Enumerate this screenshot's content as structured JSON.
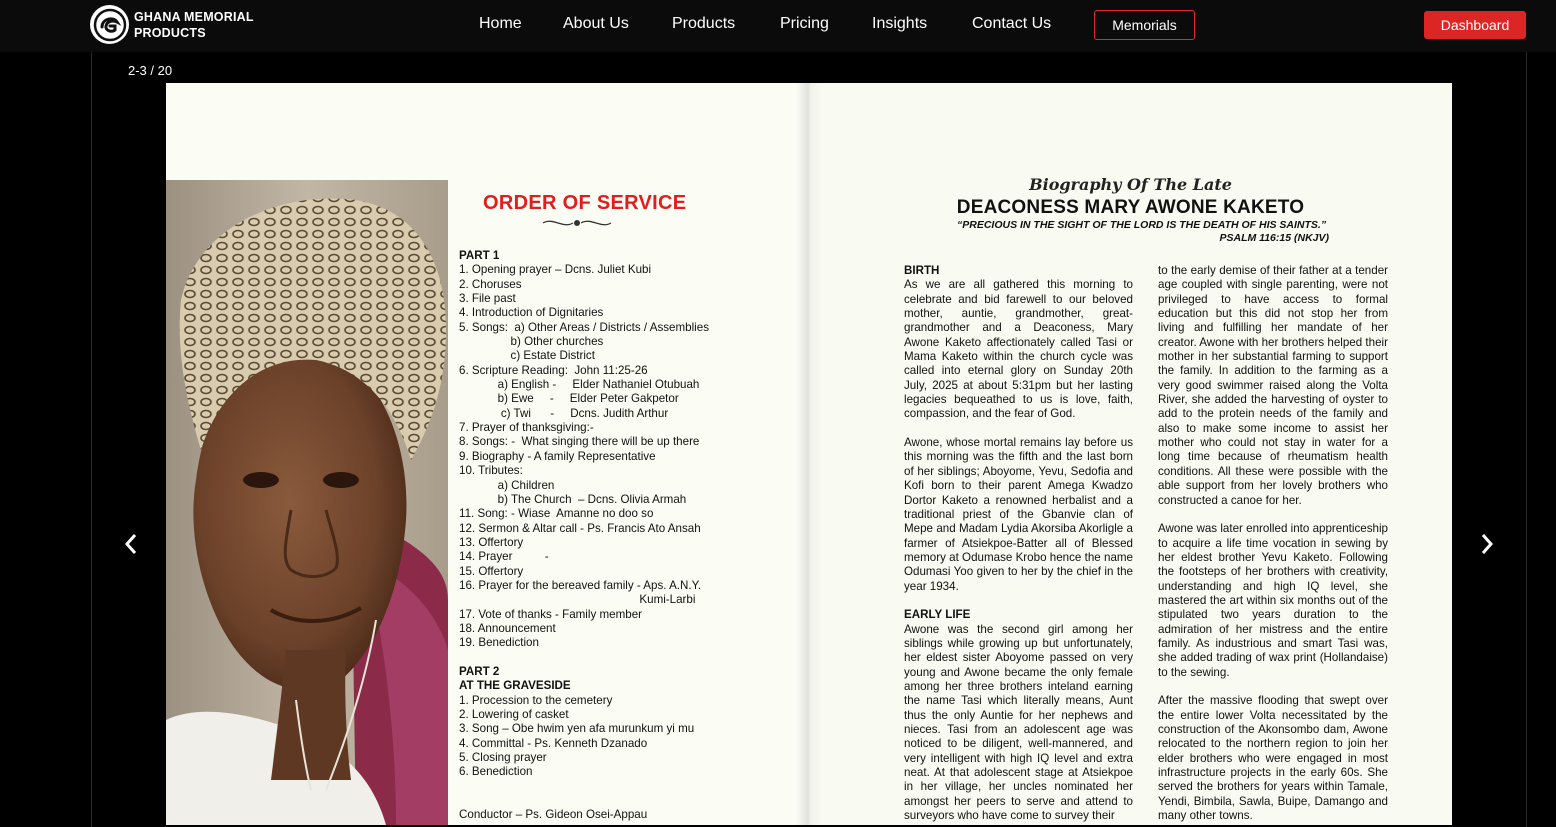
{
  "brand": {
    "line1": "GHANA MEMORIAL",
    "line2": "PRODUCTS",
    "logo_icon": "memorial-logo-icon"
  },
  "nav": {
    "home": "Home",
    "about": "About Us",
    "products": "Products",
    "pricing": "Pricing",
    "insights": "Insights",
    "contact": "Contact Us",
    "memorials": "Memorials",
    "dashboard": "Dashboard"
  },
  "colors": {
    "accent": "#dc2626",
    "nav_bg": "#0b0b0b"
  },
  "viewer": {
    "counter": "2-3 / 20",
    "prev_icon": "chevron-left-icon",
    "next_icon": "chevron-right-icon"
  },
  "order": {
    "title": "ORDER OF SERVICE",
    "part1": "PART 1",
    "lines1": [
      "1. Opening prayer – Dcns. Juliet Kubi",
      "2. Choruses",
      "3. File past",
      "4. Introduction of Dignitaries",
      "5. Songs:  a) Other Areas / Districts / Assemblies",
      "                b) Other churches",
      "                c) Estate District",
      "6. Scripture Reading:  John 11:25-26",
      "            a) English -     Elder Nathaniel Otubuah",
      "            b) Ewe     -     Elder Peter Gakpetor",
      "             c) Twi      -     Dcns. Judith Arthur",
      "7. Prayer of thanksgiving:-",
      "8. Songs: -  What singing there will be up there",
      "9. Biography - A family Representative",
      "10. Tributes:",
      "            a) Children",
      "            b) The Church  – Dcns. Olivia Armah",
      "11. Song: - Wiase  Amanne no doo so",
      "12. Sermon & Altar call - Ps. Francis Ato Ansah",
      "13. Offertory",
      "14. Prayer          -",
      "15. Offertory",
      "16. Prayer for the bereaved family - Aps. A.N.Y.",
      "                                                        Kumi-Larbi",
      "17. Vote of thanks - Family member",
      "18. Announcement",
      "19. Benediction"
    ],
    "part2": "PART 2",
    "graveside": "AT THE GRAVESIDE",
    "lines2": [
      "1. Procession to the cemetery",
      "2. Lowering of casket",
      "3. Song – Obe hwim yen afa murunkum yi mu",
      "4. Committal - Ps. Kenneth Dzanado",
      "5. Closing prayer",
      "6. Benediction"
    ],
    "conductor": "Conductor – Ps. Gideon Osei-Appau"
  },
  "bio": {
    "script_title": "Biography Of The Late",
    "name": "DEACONESS MARY AWONE KAKETO",
    "quote": "“PRECIOUS IN THE SIGHT OF THE LORD IS THE DEATH OF HIS SAINTS.”",
    "psalm": "PSALM 116:15 (NKJV)",
    "birth_heading": "BIRTH",
    "birth_p1": "As we are all gathered this morning to celebrate and bid farewell to our beloved mother, auntie, grandmother, great-grandmother and a Deaconess, Mary Awone Kaketo affectionately called Tasi or Mama Kaketo within the church cycle was called into eternal glory on Sunday 20th July, 2025 at about 5:31pm but her lasting legacies bequeathed to us is love, faith, compassion, and the fear of God.",
    "birth_p2": "Awone, whose mortal remains lay before us this morning was the fifth and the last born of her siblings; Aboyome, Yevu, Sedofia and Kofi born to their parent Amega Kwadzo Dortor Kaketo a renowned herbalist and a traditional priest of the Gbanvie clan of Mepe and Madam Lydia Akorsiba Akorligle a farmer of Atsiekpoe-Batter all of Blessed memory at Odumase Krobo hence the name Odumasi Yoo given to her by the chief in the year 1934.",
    "early_heading": "EARLY LIFE",
    "early_p1": "Awone was the second girl among her siblings while growing up but unfortunately, her eldest sister Aboyome passed on very young and Awone became the only female among her three brothers inteland earning the name Tasi which literally means, Aunt thus the only Auntie for her nephews and nieces. Tasi from an adolescent age was noticed to be diligent, well-mannered, and very intelligent with high IQ level and extra neat. At that adolescent stage at Atsiekpoe in her village, her uncles nominated her amongst her peers to serve and attend to surveyors who have come to survey their",
    "col2_p1": "to the early demise of their father at a tender age coupled with single parenting, were not privileged to have access to formal education but this did not stop her from living and fulfilling her mandate of her creator. Awone with her brothers helped their mother in her substantial farming to support the family. In addition to the farming as a very good swimmer raised along the Volta River, she added the harvesting of oyster to add to the protein needs of the family and also to make some income to assist her mother who could not stay in water for a long time because of rheumatism health conditions. All these were possible with the able support from her lovely brothers who constructed a canoe for her.",
    "col2_p2": "Awone was later enrolled into apprenticeship to acquire a life time vocation in sewing by her eldest brother Yevu Kaketo. Following the footsteps of her brothers with creativity, understanding and high IQ level, she mastered the art within six months out of the stipulated two years duration to the admiration of her mistress and the entire family. As industrious and smart Tasi was, she added trading of wax print (Hollandaise) to the sewing.",
    "col2_p3": "After the massive flooding that swept over the entire lower Volta necessitated by the construction of the Akonsombo dam, Awone relocated to the northern region to join her elder brothers who were engaged in most infrastructure projects in the early 60s. She served the brothers for years within Tamale, Yendi, Bimbila, Sawla, Buipe, Damango and many other towns."
  }
}
